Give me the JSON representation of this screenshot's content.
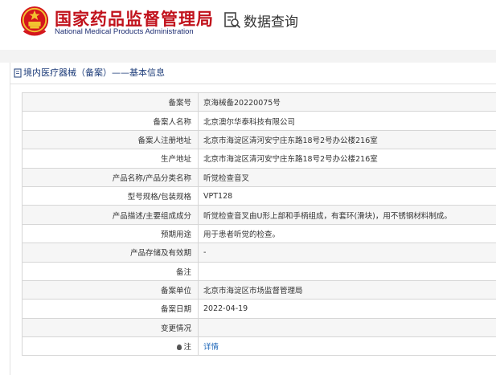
{
  "header": {
    "title_cn": "国家药品监督管理局",
    "title_en": "National Medical Products Administration",
    "query_label": "数据查询"
  },
  "panel": {
    "title": "境内医疗器械（备案）——基本信息"
  },
  "rows": [
    {
      "label": "备案号",
      "value": "京海械备20220075号"
    },
    {
      "label": "备案人名称",
      "value": "北京澳尔华泰科技有限公司"
    },
    {
      "label": "备案人注册地址",
      "value": "北京市海淀区清河安宁庄东路18号2号办公楼216室"
    },
    {
      "label": "生产地址",
      "value": "北京市海淀区清河安宁庄东路18号2号办公楼216室"
    },
    {
      "label": "产品名称/产品分类名称",
      "value": "听觉检查音叉"
    },
    {
      "label": "型号规格/包装规格",
      "value": "VPT128"
    },
    {
      "label": "产品描述/主要组成成分",
      "value": "听觉检查音叉由U形上部和手柄组成，有套环(滑块)，用不锈钢材料制成。"
    },
    {
      "label": "预期用途",
      "value": "用于患者听觉的检查。"
    },
    {
      "label": "产品存储及有效期",
      "value": "-"
    },
    {
      "label": "备注",
      "value": ""
    },
    {
      "label": "备案单位",
      "value": "北京市海淀区市场监督管理局"
    },
    {
      "label": "备案日期",
      "value": "2022-04-19"
    },
    {
      "label": "变更情况",
      "value": ""
    },
    {
      "label": "注",
      "value": "详情"
    }
  ],
  "colors": {
    "brand_red": "#c1121c",
    "brand_navy": "#1f2f73",
    "link_blue": "#1a64b8"
  }
}
